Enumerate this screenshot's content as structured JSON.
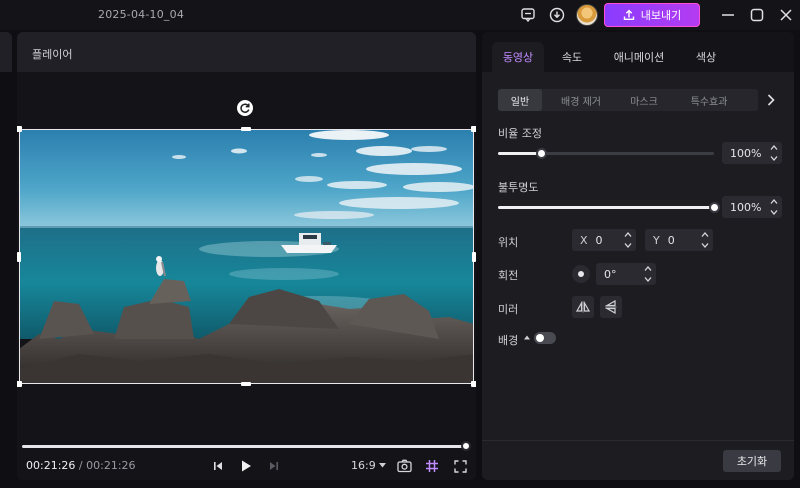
{
  "titlebar": {
    "project_name": "2025-04-10_04",
    "export_label": "내보내기",
    "icons": [
      "feedback-icon",
      "download-icon",
      "avatar",
      "upload-icon",
      "minimize-icon",
      "maximize-icon",
      "close-icon"
    ]
  },
  "player": {
    "title": "플레이어",
    "current_time": "00:21:26",
    "separator": "/",
    "total_time": "00:21:26",
    "progress": 1.0,
    "aspect_ratio": "16:9",
    "icons": [
      "prev-frame-icon",
      "play-icon",
      "next-frame-icon",
      "chevron-down-icon",
      "snapshot-icon",
      "grid-icon",
      "fullscreen-icon",
      "rotate-icon"
    ]
  },
  "panel": {
    "tabs": [
      {
        "label": "동영상",
        "active": true
      },
      {
        "label": "속도",
        "active": false
      },
      {
        "label": "애니메이션",
        "active": false
      },
      {
        "label": "색상",
        "active": false
      }
    ],
    "subtabs": [
      {
        "label": "일반",
        "active": true
      },
      {
        "label": "배경 제거",
        "active": false
      },
      {
        "label": "마스크",
        "active": false
      },
      {
        "label": "특수효과",
        "active": false
      }
    ],
    "scale": {
      "label": "비율 조정",
      "value": "100%",
      "level": 0.2
    },
    "opacity": {
      "label": "불투명도",
      "value": "100%",
      "level": 1.0
    },
    "position": {
      "label": "위치",
      "x_label": "X",
      "x_value": "0",
      "y_label": "Y",
      "y_value": "0"
    },
    "rotation": {
      "label": "회전",
      "value": "0°"
    },
    "mirror": {
      "label": "미러"
    },
    "background": {
      "label": "배경",
      "enabled": false
    },
    "reset_label": "초기화",
    "colors": {
      "accent": "#c08cff",
      "export_gradient_start": "#8a3cff",
      "export_gradient_end": "#b43cf0",
      "export_border": "#ff4fd8"
    }
  }
}
